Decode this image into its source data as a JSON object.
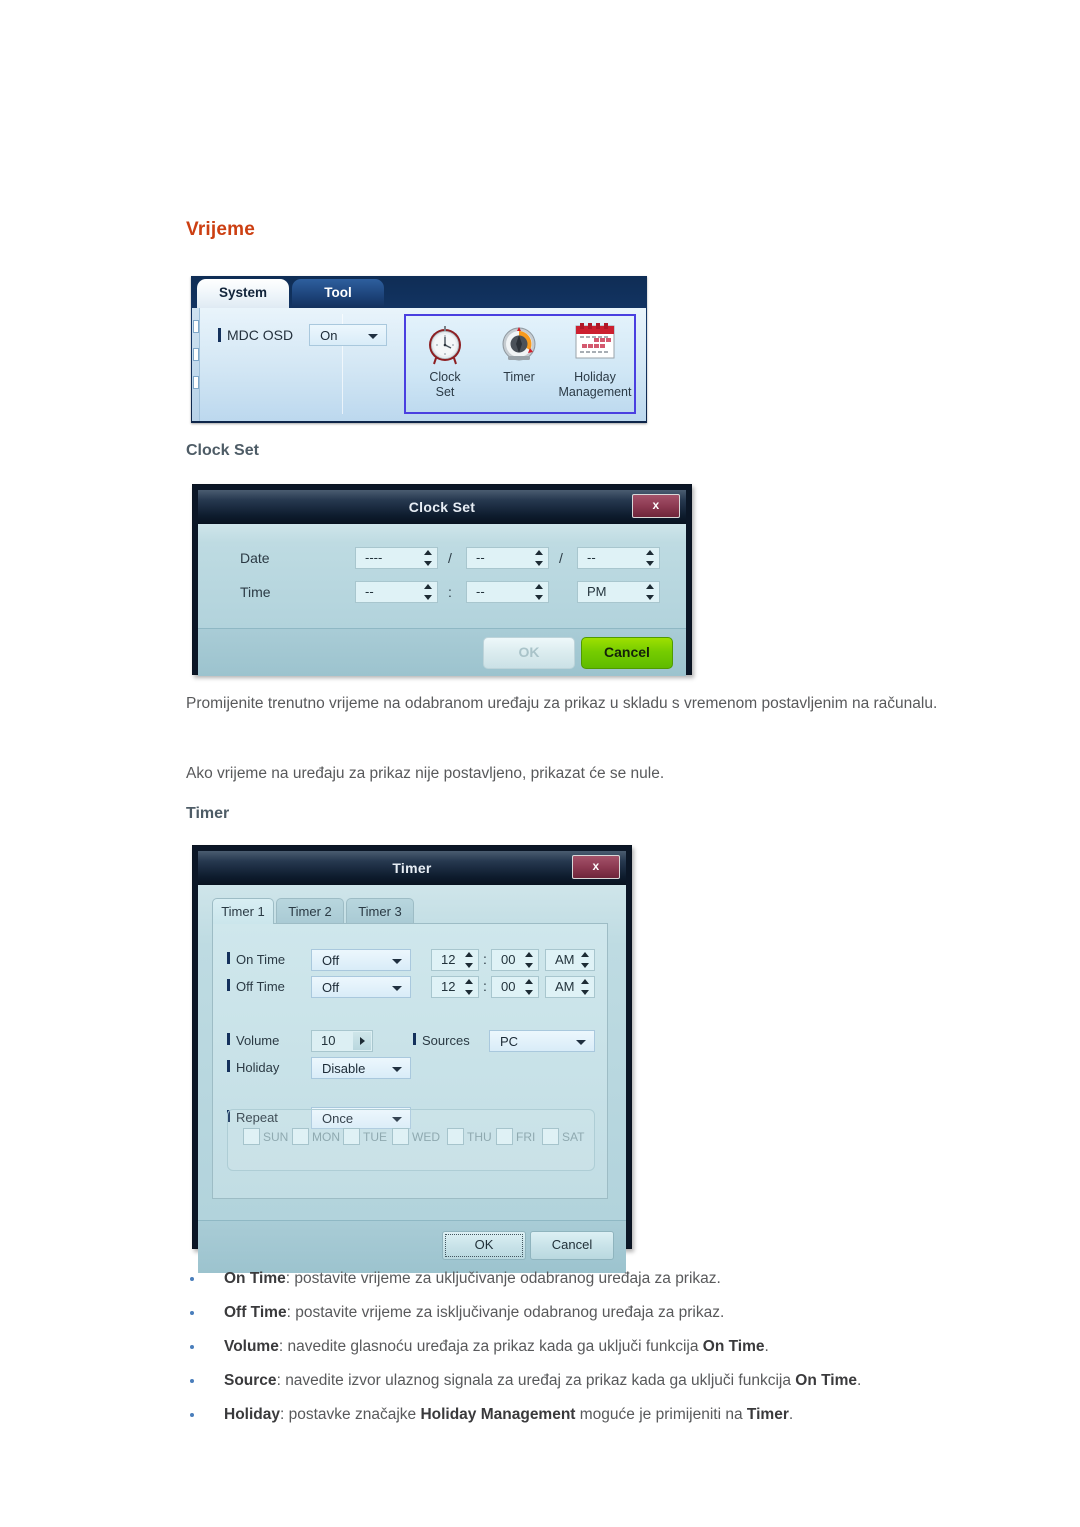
{
  "page": {
    "title": "Vrijeme",
    "subtitle_clock": "Clock Set",
    "subtitle_timer": "Timer",
    "accent_color": "#cc3f12",
    "paragraph_1": "Promijenite trenutno vrijeme na odabranom uređaju za prikaz u skladu s vremenom postavljenim na računalu.",
    "paragraph_2": "Ako vrijeme na uređaju za prikaz nije postavljeno, prikazat će se nule."
  },
  "mdc_panel": {
    "tabs": [
      {
        "label": "System",
        "active": true
      },
      {
        "label": "Tool",
        "active": false
      }
    ],
    "osd": {
      "label": "MDC OSD",
      "value": "On"
    },
    "icons": [
      {
        "name": "clock-set-icon",
        "label_line1": "Clock",
        "label_line2": "Set"
      },
      {
        "name": "timer-icon",
        "label_line1": "Timer",
        "label_line2": ""
      },
      {
        "name": "holiday-management-icon",
        "label_line1": "Holiday",
        "label_line2": "Management"
      }
    ],
    "selection_border_color": "#4a3fe0"
  },
  "clock_set_dialog": {
    "title": "Clock Set",
    "close_label": "x",
    "date_label": "Date",
    "time_label": "Time",
    "date_year": "----",
    "date_month": "--",
    "date_day": "--",
    "date_sep_1": "/",
    "date_sep_2": "/",
    "time_hour": "--",
    "time_minute": "--",
    "time_meridiem": "PM",
    "time_sep": ":",
    "ok_label": "OK",
    "cancel_label": "Cancel",
    "cancel_color": "#76cc00"
  },
  "timer_dialog": {
    "title": "Timer",
    "close_label": "x",
    "tabs": [
      {
        "label": "Timer 1",
        "active": true
      },
      {
        "label": "Timer 2",
        "active": false
      },
      {
        "label": "Timer 3",
        "active": false
      }
    ],
    "on_time": {
      "label": "On Time",
      "mode": "Off",
      "hour": "12",
      "minute": "00",
      "meridiem": "AM",
      "sep": ":"
    },
    "off_time": {
      "label": "Off Time",
      "mode": "Off",
      "hour": "12",
      "minute": "00",
      "meridiem": "AM",
      "sep": ":"
    },
    "volume": {
      "label": "Volume",
      "value": "10"
    },
    "sources": {
      "label": "Sources",
      "value": "PC"
    },
    "holiday": {
      "label": "Holiday",
      "value": "Disable"
    },
    "repeat": {
      "label": "Repeat",
      "value": "Once"
    },
    "weekdays": [
      {
        "label": "SUN",
        "checked": false
      },
      {
        "label": "MON",
        "checked": false
      },
      {
        "label": "TUE",
        "checked": false
      },
      {
        "label": "WED",
        "checked": false
      },
      {
        "label": "THU",
        "checked": false
      },
      {
        "label": "FRI",
        "checked": false
      },
      {
        "label": "SAT",
        "checked": false
      }
    ],
    "ok_label": "OK",
    "cancel_label": "Cancel"
  },
  "bullets": [
    {
      "term": "On Time",
      "sep": ": ",
      "text": "postavite vrijeme za uključivanje odabranog uređaja za prikaz."
    },
    {
      "term": "Off Time",
      "sep": ": ",
      "text": "postavite vrijeme za isključivanje odabranog uređaja za prikaz."
    },
    {
      "term": "Volume",
      "sep": ": ",
      "text": "navedite glasnoću uređaja za prikaz kada ga uključi funkcija ",
      "term_2": "On Time",
      "text_2": "."
    },
    {
      "term": "Source",
      "sep": ": ",
      "text": "navedite izvor ulaznog signala za uređaj za prikaz kada ga uključi funkcija ",
      "term_2": "On Time",
      "text_2": "."
    },
    {
      "term": "Holiday",
      "sep": ": ",
      "text": "postavke značajke ",
      "term_2": "Holiday Management",
      "text_2": " moguće je primijeniti na ",
      "term_3": "Timer",
      "text_3": "."
    }
  ]
}
